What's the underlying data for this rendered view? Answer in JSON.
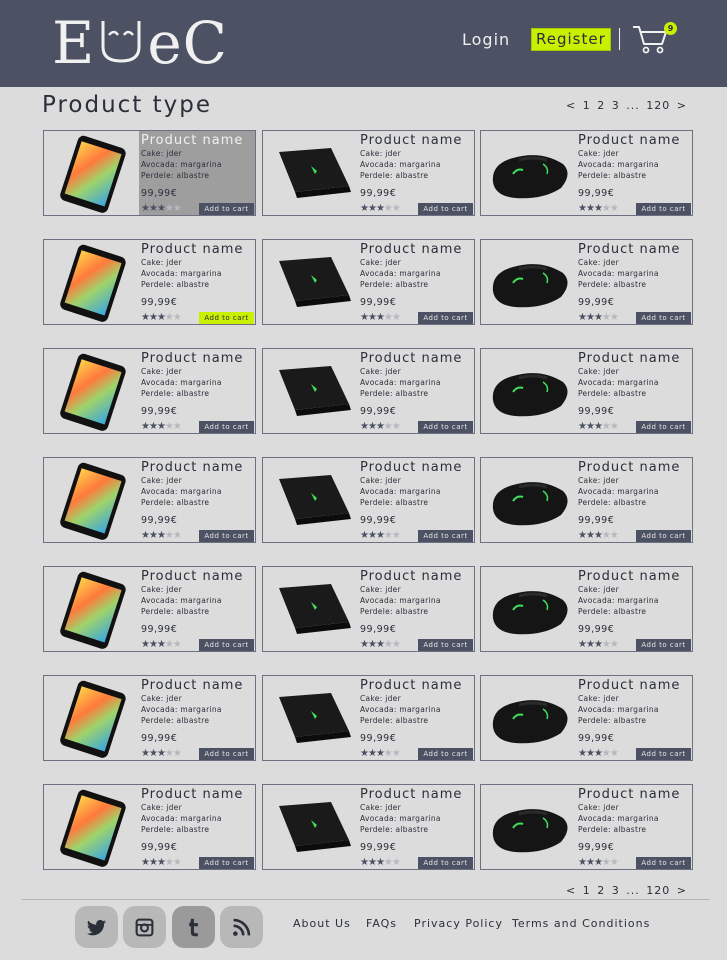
{
  "header": {
    "logo_text_left": "E",
    "logo_text_right": "eC",
    "login_label": "Login",
    "register_label": "Register",
    "cart_count": "9"
  },
  "page": {
    "title": "Product type"
  },
  "pagination": {
    "prev": "<",
    "pages": [
      "1",
      "2",
      "3"
    ],
    "ellipsis": "...",
    "last": "120",
    "next": ">"
  },
  "product_template": {
    "name": "Product name",
    "desc_1": "Cake: jder",
    "desc_2": "Avocada: margarina",
    "desc_3": "Perdele: albastre",
    "price": "99,99€",
    "rating": 3,
    "rating_max": 5,
    "add_to_cart": "Add to cart"
  },
  "product_images": [
    "phone",
    "laptop",
    "mouse"
  ],
  "rows": 7,
  "footer": {
    "social": [
      "twitter-icon",
      "instagram-icon",
      "tumblr-icon",
      "rss-icon"
    ],
    "links": [
      "About Us",
      "FAQs",
      "Privacy Policy",
      "Terms and Conditions"
    ]
  },
  "colors": {
    "header_bg": "#4c5163",
    "accent": "#c8f000",
    "page_bg": "#dcdcdc"
  }
}
